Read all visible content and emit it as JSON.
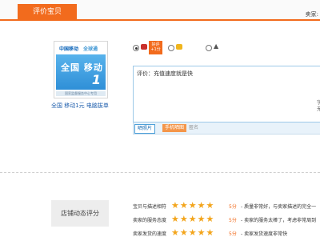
{
  "header": {
    "tab_label": "评价宝贝",
    "seller_label": "卖家:"
  },
  "product": {
    "card_logo_left": "中国移动",
    "card_logo_right": "全球通",
    "card_text": "全国 移动",
    "card_number": "1",
    "card_stripe": "国家监督服务中心专用",
    "name": "全国 移动1元 电脑拔单"
  },
  "rating": {
    "tip_line1": "好评",
    "tip_line2": "+1分"
  },
  "comment": {
    "text": "评价：充值速度就是快",
    "side_note_1": "字",
    "side_note_2": "无"
  },
  "toolbar": {
    "add_image": "晒照片",
    "phone_image": "手机晒图",
    "anonymous": "匿名"
  },
  "store": {
    "label": "店铺动态评分",
    "rows": [
      {
        "question": "宝贝与描述相符",
        "stars": "★★★★★",
        "score": "5分",
        "desc": "- 质量非常好，与卖家描述的完全一"
      },
      {
        "question": "卖家的服务态度",
        "stars": "★★★★★",
        "score": "5分",
        "desc": "- 卖家的服务太棒了，考虑非常周到"
      },
      {
        "question": "卖家发货的速度",
        "stars": "★★★★★",
        "score": "5分",
        "desc": "- 卖家发货速度非常快"
      }
    ]
  }
}
